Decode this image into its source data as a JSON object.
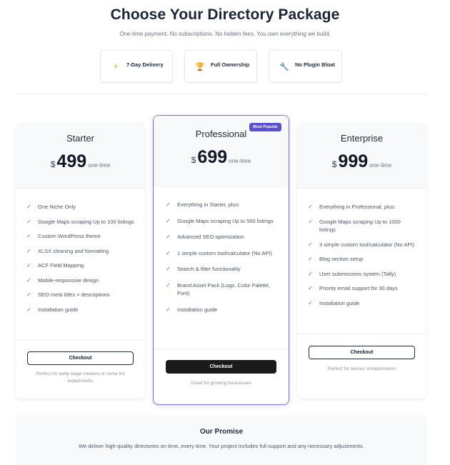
{
  "header": {
    "title": "Choose Your Directory Package",
    "subtitle": "One-time payment. No subscriptions. No hidden fees. You own everything we build."
  },
  "features": [
    {
      "label": "7-Day Delivery",
      "icon": "lightning-bolt-icon",
      "glyph": "⚡"
    },
    {
      "label": "Full Ownership",
      "icon": "trophy-icon",
      "glyph": "🏆"
    },
    {
      "label": "No Plugin Bloat",
      "icon": "wrench-icon",
      "glyph": "🔧"
    }
  ],
  "plans": {
    "starter": {
      "name": "Starter",
      "currency": "$",
      "price": "499",
      "period": "one-time",
      "features": [
        "One Niche Only",
        "Google Maps scraping Up to 100 listings",
        "Custom WordPress theme",
        "XLSX cleaning and formatting",
        "ACF Field Mapping",
        "Mobile-responsive design",
        "SEO meta titles + descriptions",
        "Installation guide"
      ],
      "button": "Checkout",
      "note": "Perfect for early-stage creators or niche list experiments"
    },
    "professional": {
      "name": "Professional",
      "badge": "Most Popular",
      "currency": "$",
      "price": "699",
      "period": "one-time",
      "features": [
        "Everything in Starter, plus:",
        "Google Maps scraping Up to 500 listings",
        "Advanced SEO optimization",
        "1 simple custom tool/calculator (No API)",
        "Search & filter functionality",
        "Brand Asset Pack (Logo, Color Palette, Font)",
        "Installation guide"
      ],
      "button": "Checkout",
      "note": "Great for growing businesses"
    },
    "enterprise": {
      "name": "Enterprise",
      "currency": "$",
      "price": "999",
      "period": "one-time",
      "features": [
        "Everything in Professional, plus:",
        "Google Maps scraping Up to 1000 listings",
        "3 simple custom tool/calculator (No API)",
        "Blog section setup",
        "User submissions system (Tally)",
        "Priority email support for 30 days",
        "Installation guide"
      ],
      "button": "Checkout",
      "note": "Perfect for serious entrepreneurs"
    }
  },
  "check_glyph": "✓",
  "promise": {
    "title": "Our Promise",
    "text": "We deliver high-quality directories on time, every time. Your project includes full support and any necessary adjustments."
  },
  "colors": {
    "accent": "#5b4fd6",
    "featured_border": "#7c6fe0",
    "primary_button": "#1a1a1a"
  }
}
